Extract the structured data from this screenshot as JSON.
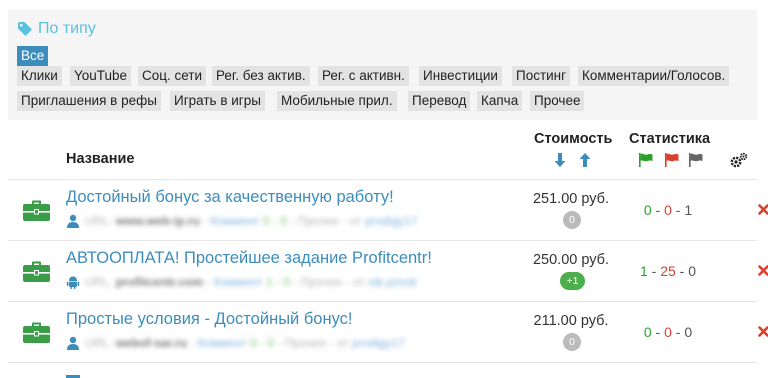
{
  "filter": {
    "title": "По типу",
    "title_icon": "tag-icon",
    "chips": [
      {
        "label": "Все",
        "active": true
      },
      {
        "label": "Клики",
        "active": false
      },
      {
        "label": "YouTube",
        "active": false
      },
      {
        "label": "Соц. сети",
        "active": false
      },
      {
        "label": "Рег. без актив.",
        "active": false
      },
      {
        "label": "Рег. с активн.",
        "active": false
      },
      {
        "label": "Инвестиции",
        "active": false
      },
      {
        "label": "Постинг",
        "active": false
      },
      {
        "label": "Комментарии/Голосов.",
        "active": false
      },
      {
        "label": "Приглашения в рефы",
        "active": false
      },
      {
        "label": "Играть в игры",
        "active": false
      },
      {
        "label": "Мобильные прил.",
        "active": false
      },
      {
        "label": "Перевод",
        "active": false
      },
      {
        "label": "Капча",
        "active": false
      },
      {
        "label": "Прочее",
        "active": false
      }
    ]
  },
  "table": {
    "col_name": "Название",
    "col_cost": "Стоимость",
    "col_stats": "Статистика",
    "sort_icons": [
      "arrow-down-icon",
      "arrow-up-icon"
    ],
    "flag_icons": [
      "green-flag-icon",
      "red-flag-icon",
      "gray-flag-icon"
    ],
    "settings_icon": "gears-icon",
    "colors": {
      "green": "#2e9e2e",
      "red": "#d9412f",
      "gray": "#666666",
      "link": "#3c8dbc",
      "accent": "#3c8dbc"
    },
    "rows": [
      {
        "icon": "briefcase-icon",
        "title": "Достойный бонус за качественную работу!",
        "platform_icon": "user-icon",
        "meta": {
          "url_label": "URL:",
          "url": "www.web-ip.ru",
          "comment_label": "Коммент",
          "comment": "0 - 0",
          "type": "Прочее",
          "from_label": "от",
          "author": "prodigy17"
        },
        "price": "251.00 руб.",
        "badge": "0",
        "badge_color": "#bbbbbb",
        "stats": [
          "0",
          "0",
          "1"
        ],
        "delete_icon": "close-icon"
      },
      {
        "icon": "briefcase-icon",
        "title": "АВТООПЛАТА! Простейшее задание Profitcentr!",
        "platform_icon": "android-icon",
        "meta": {
          "url_label": "URL:",
          "url": "profitcentr.com",
          "comment_label": "Коммент",
          "comment": "1 - 0",
          "type": "Прочее",
          "from_label": "от",
          "author": "nik-privat"
        },
        "price": "250.00 руб.",
        "badge": "+1",
        "badge_color": "#4cae4c",
        "stats": [
          "1",
          "25",
          "0"
        ],
        "delete_icon": "close-icon"
      },
      {
        "icon": "briefcase-icon",
        "title": "Простые условия - Достойный бонус!",
        "platform_icon": "user-icon",
        "meta": {
          "url_label": "URL:",
          "url": "webof-sar.ru",
          "comment_label": "Коммент",
          "comment": "0 - 0",
          "type": "Прочее",
          "from_label": "от",
          "author": "prodigy17"
        },
        "price": "211.00 руб.",
        "badge": "0",
        "badge_color": "#bbbbbb",
        "stats": [
          "0",
          "0",
          "0"
        ],
        "delete_icon": "close-icon"
      }
    ]
  }
}
